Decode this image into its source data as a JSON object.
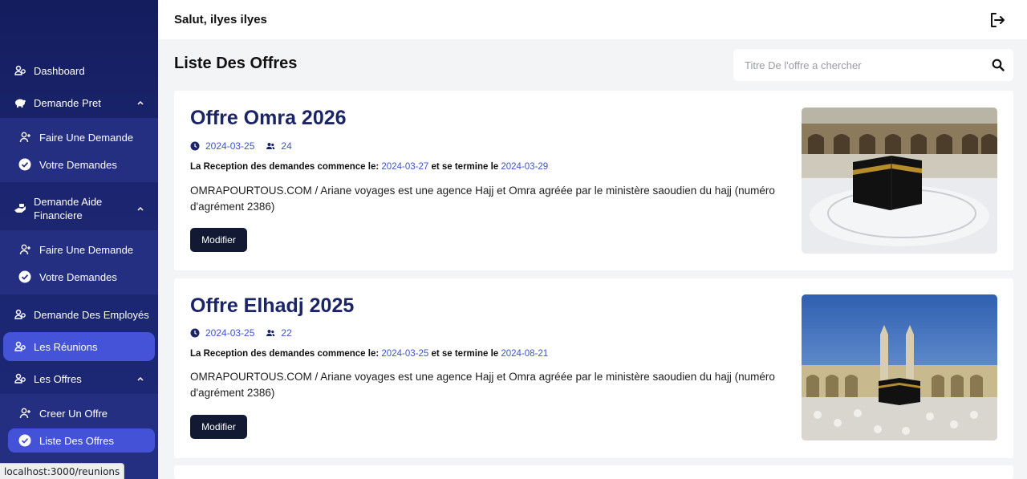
{
  "header": {
    "greeting": "Salut, ilyes ilyes"
  },
  "sidebar": {
    "dashboard": "Dashboard",
    "demande_pret": "Demande Pret",
    "pret_faire": "Faire Une Demande",
    "pret_votre": "Votre Demandes",
    "aide_line1": "Demande Aide",
    "aide_line2": "Financiere",
    "aide_faire": "Faire Une Demande",
    "aide_votre": "Votre Demandes",
    "employes": "Demande Des Employés",
    "reunions": "Les Réunions",
    "offres": "Les Offres",
    "creer": "Creer Un Offre",
    "liste": "Liste Des Offres"
  },
  "status_url": "localhost:3000/reunions",
  "page": {
    "title": "Liste Des Offres",
    "search_placeholder": "Titre De l'offre a chercher"
  },
  "offers": [
    {
      "title": "Offre Omra 2026",
      "date": "2024-03-25",
      "count": "24",
      "reception_prefix": "La Reception des demandes commence le:",
      "start": "2024-03-27",
      "middle": "et se termine le",
      "end": "2024-03-29",
      "description": "OMRAPOURTOUS.COM / Ariane voyages est une agence Hajj et Omra agréée par le ministère saoudien du hajj (numéro d'agrément 2386)",
      "button": "Modifier"
    },
    {
      "title": "Offre Elhadj 2025",
      "date": "2024-03-25",
      "count": "22",
      "reception_prefix": "La Reception des demandes commence le:",
      "start": "2024-03-25",
      "middle": "et se termine le",
      "end": "2024-08-21",
      "description": "OMRAPOURTOUS.COM / Ariane voyages est une agence Hajj et Omra agréée par le ministère saoudien du hajj (numéro d'agrément 2386)",
      "button": "Modifier"
    }
  ]
}
